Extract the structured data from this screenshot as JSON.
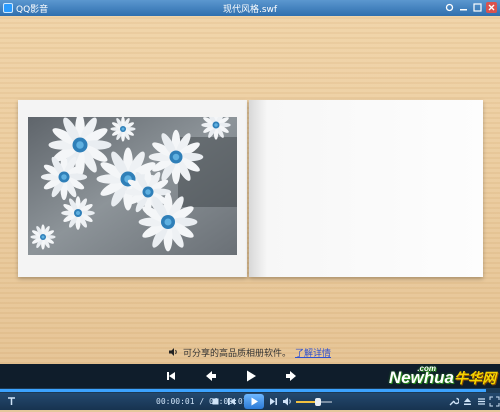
{
  "app": {
    "name": "QQ影音",
    "window_title": "现代风格.swf"
  },
  "window_buttons": [
    "settings-icon",
    "minimize-icon",
    "maximize-icon",
    "close-icon"
  ],
  "stage": {
    "caption_text": "可分享的高品质相册软件。",
    "caption_link": "了解详情"
  },
  "playback": {
    "time_display": "00:00:01 / 00:00:01",
    "progress": 1.0,
    "volume": 0.6
  },
  "watermark": {
    "text": "Newhua",
    "cn": "牛华网",
    "dotcom": ".com"
  },
  "colors": {
    "accent": "#3ca3ff",
    "titlebar": "#2f6fae",
    "control_bg": "#0f1d2b"
  }
}
